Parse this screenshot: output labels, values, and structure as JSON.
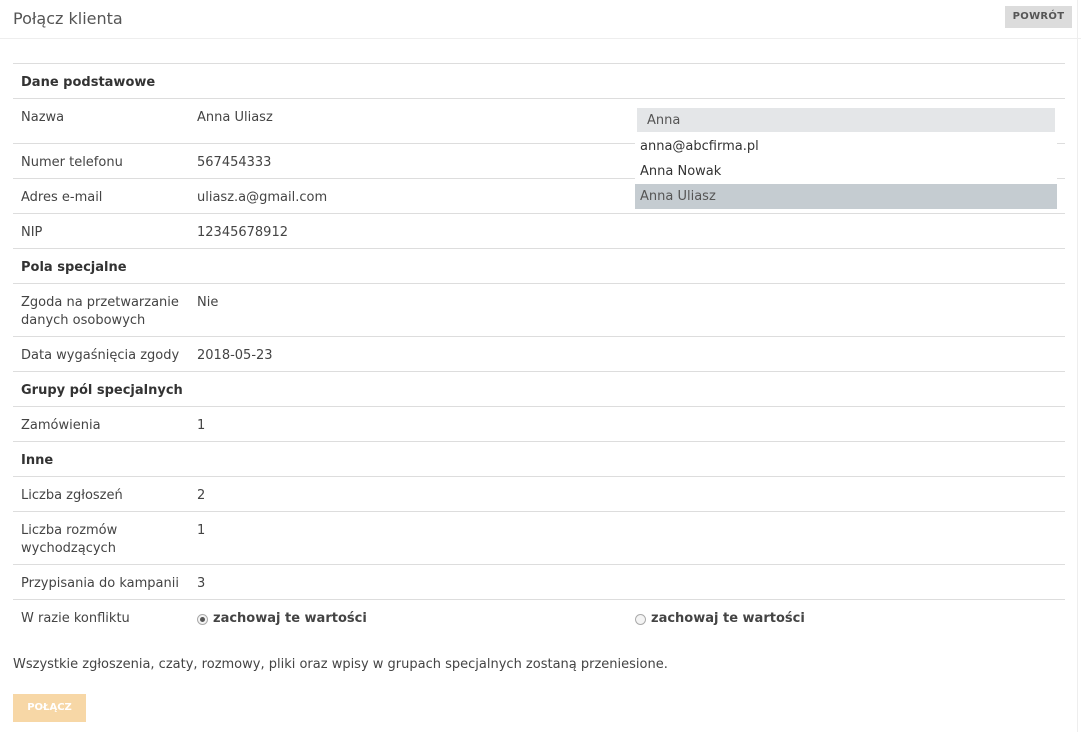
{
  "header": {
    "title": "Połącz klienta",
    "back_label": "POWRÓT"
  },
  "sections": {
    "basic": "Dane podstawowe",
    "special": "Pola specjalne",
    "special_groups": "Grupy pól specjalnych",
    "other": "Inne"
  },
  "fields": {
    "name": {
      "label": "Nazwa",
      "value": "Anna Uliasz"
    },
    "phone": {
      "label": "Numer telefonu",
      "value": "567454333"
    },
    "email": {
      "label": "Adres e-mail",
      "value": "uliasz.a@gmail.com"
    },
    "nip": {
      "label": "NIP",
      "value": "12345678912"
    },
    "consent": {
      "label": "Zgoda na przetwarzanie danych osobowych",
      "value": "Nie"
    },
    "consent_expiry": {
      "label": "Data wygaśnięcia zgody",
      "value": "2018-05-23"
    },
    "orders": {
      "label": "Zamówienia",
      "value": "1"
    },
    "tickets": {
      "label": "Liczba zgłoszeń",
      "value": "2"
    },
    "outgoing_calls": {
      "label": "Liczba rozmów wychodzących",
      "value": "1"
    },
    "campaigns": {
      "label": "Przypisania do kampanii",
      "value": "3"
    }
  },
  "conflict": {
    "label": "W razie konfliktu",
    "left_option": "zachowaj te wartości",
    "right_option": "zachowaj te wartości",
    "selected": "left"
  },
  "search": {
    "value": "Anna",
    "results": [
      "anna@abcfirma.pl",
      "Anna Nowak",
      "Anna Uliasz"
    ],
    "selected_index": 2
  },
  "footer": {
    "note": "Wszystkie zgłoszenia, czaty, rozmowy, pliki oraz wpisy w grupach specjalnych zostaną przeniesione.",
    "connect_label": "POŁĄCZ"
  },
  "colors": {
    "connect_button": "#f7d7a6",
    "selected_item": "#c5ccd1",
    "search_bg": "#e4e6e8"
  }
}
